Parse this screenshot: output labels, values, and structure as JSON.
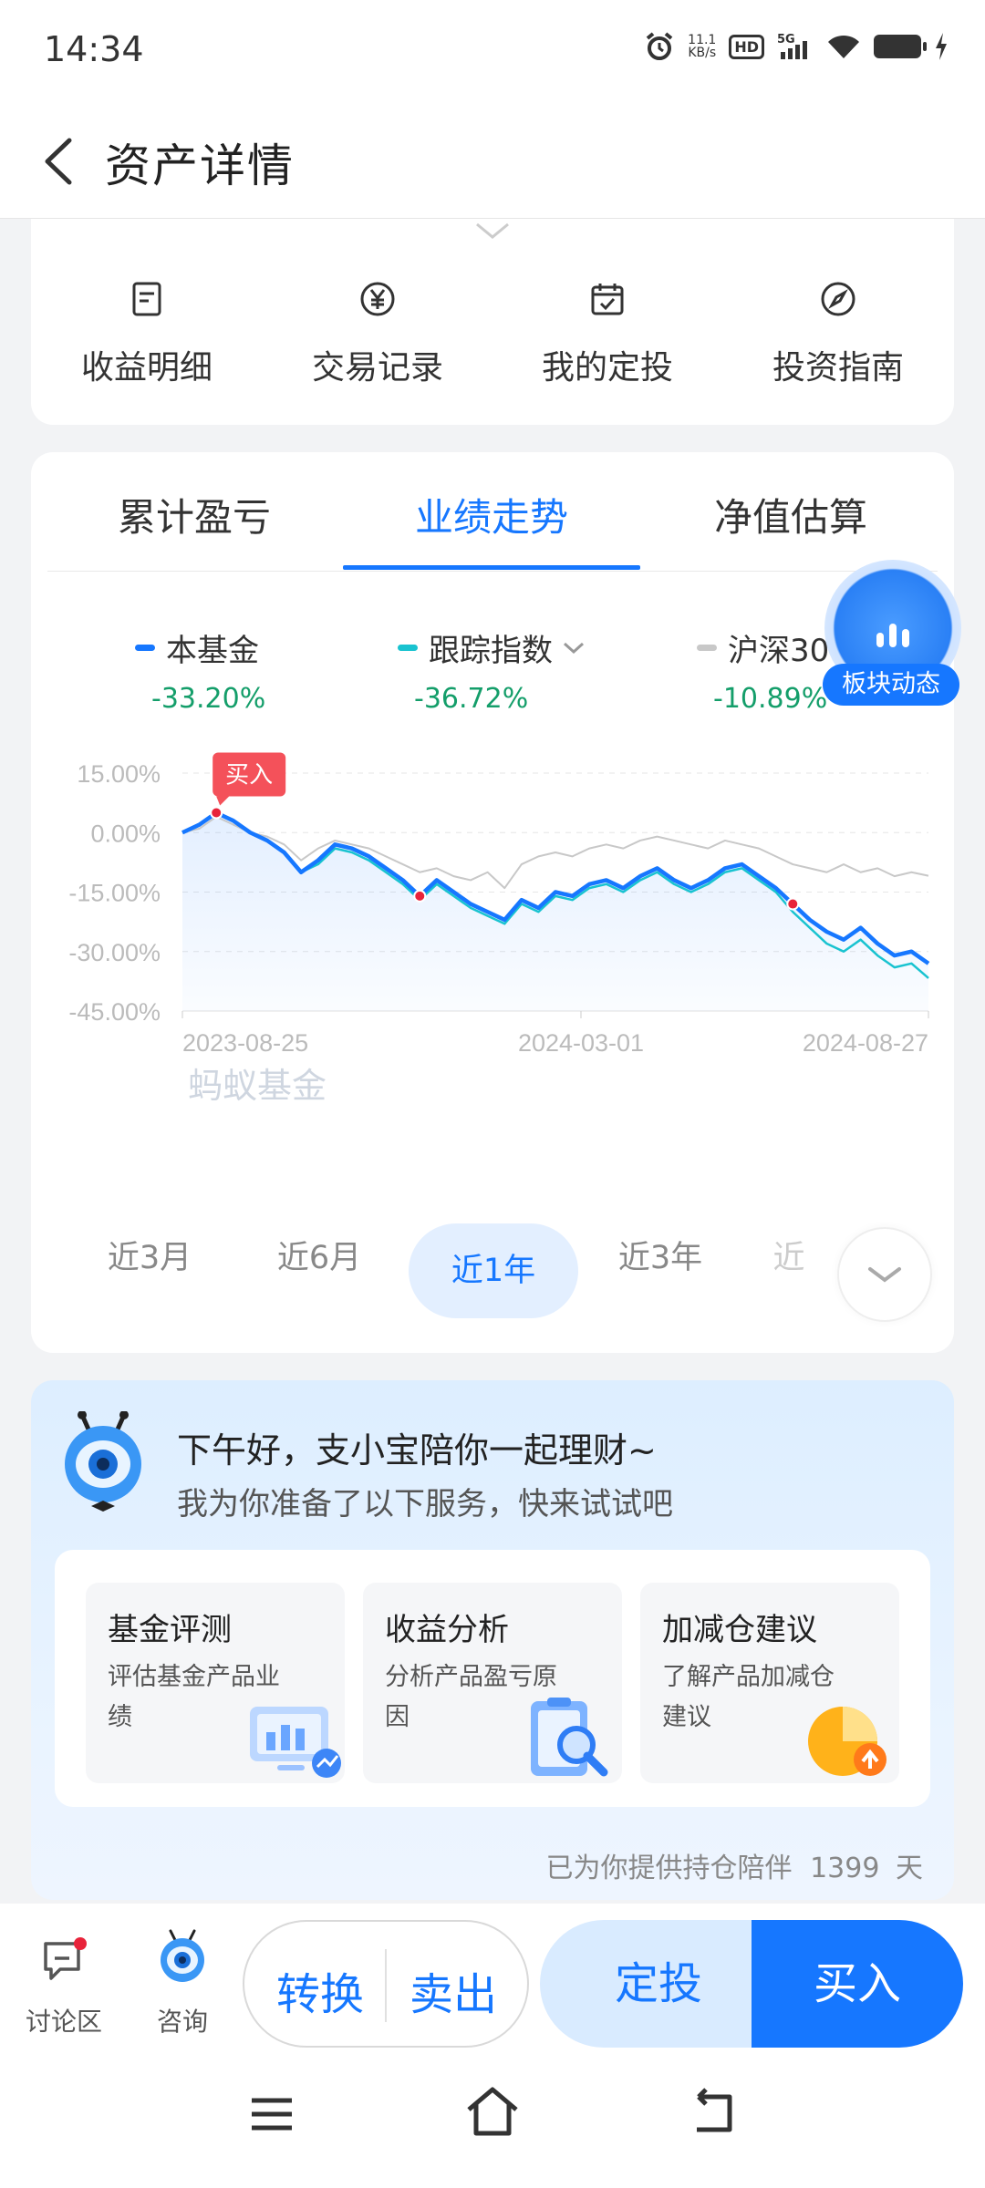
{
  "status_bar": {
    "time": "14:34",
    "net_speed_value": "11.1",
    "net_speed_unit": "KB/s",
    "hd": "HD",
    "signal": "5G"
  },
  "header": {
    "title": "资产详情"
  },
  "quick_actions": [
    {
      "label": "收益明细",
      "icon": "list-icon"
    },
    {
      "label": "交易记录",
      "icon": "yen-circle-icon"
    },
    {
      "label": "我的定投",
      "icon": "calendar-check-icon"
    },
    {
      "label": "投资指南",
      "icon": "compass-icon"
    }
  ],
  "perf_tabs": [
    "累计盈亏",
    "业绩走势",
    "净值估算"
  ],
  "active_tab": "业绩走势",
  "legend": [
    {
      "name": "本基金",
      "value": "-33.20%",
      "color": "#1677ff"
    },
    {
      "name": "跟踪指数",
      "value": "-36.72%",
      "color": "#19c3d0"
    },
    {
      "name": "沪深300",
      "value": "-10.89%",
      "color": "#c8c8c8"
    }
  ],
  "float_button": {
    "label": "板块动态",
    "icon": "bar-chart-icon"
  },
  "chart_data": {
    "type": "line",
    "ytick_labels": [
      "15.00%",
      "0.00%",
      "-15.00%",
      "-30.00%",
      "-45.00%"
    ],
    "ylim": [
      -45,
      15
    ],
    "xtick_labels": [
      "2023-08-25",
      "2024-03-01",
      "2024-08-27"
    ],
    "watermark": "蚂蚁基金",
    "buy_marker": "买入",
    "series": [
      {
        "name": "本基金",
        "color": "#1677ff",
        "values": [
          0,
          2,
          5,
          3,
          0,
          -2,
          -5,
          -10,
          -7,
          -3,
          -4,
          -6,
          -9,
          -12,
          -16,
          -12,
          -15,
          -18,
          -20,
          -22,
          -17,
          -19,
          -15,
          -16,
          -13,
          -12,
          -14,
          -11,
          -9,
          -12,
          -14,
          -12,
          -9,
          -8,
          -11,
          -14,
          -18,
          -22,
          -25,
          -27,
          -24,
          -28,
          -31,
          -30,
          -33
        ]
      },
      {
        "name": "跟踪指数",
        "color": "#19c3d0",
        "values": [
          0,
          2,
          5,
          3,
          0,
          -2,
          -5,
          -10,
          -8,
          -4,
          -5,
          -7,
          -10,
          -13,
          -17,
          -13,
          -16,
          -19,
          -21,
          -23,
          -18,
          -20,
          -16,
          -17,
          -14,
          -13,
          -15,
          -12,
          -10,
          -13,
          -15,
          -13,
          -10,
          -9,
          -12,
          -15,
          -20,
          -24,
          -28,
          -30,
          -27,
          -31,
          -34,
          -33,
          -36.7
        ]
      },
      {
        "name": "沪深300",
        "color": "#c8c8c8",
        "values": [
          0,
          1,
          4,
          2,
          0,
          -1,
          -3,
          -7,
          -4,
          -2,
          -3,
          -4,
          -6,
          -8,
          -10,
          -9,
          -11,
          -12,
          -10,
          -14,
          -8,
          -6,
          -5,
          -6,
          -4,
          -3,
          -4,
          -2,
          -1,
          -2,
          -3,
          -4,
          -2,
          -3,
          -4,
          -6,
          -8,
          -9,
          -10,
          -8,
          -10,
          -9,
          -11,
          -10,
          -10.9
        ]
      }
    ],
    "buy_points": [
      2,
      14,
      36
    ]
  },
  "periods": [
    "近3月",
    "近6月",
    "近1年",
    "近3年",
    "近"
  ],
  "active_period": "近1年",
  "assistant": {
    "greeting": "下午好，支小宝陪你一起理财~",
    "sub": "我为你准备了以下服务，快来试试吧",
    "services": [
      {
        "title": "基金评测",
        "desc": "评估基金产品业绩",
        "icon": "monitor-chart-icon"
      },
      {
        "title": "收益分析",
        "desc": "分析产品盈亏原因",
        "icon": "magnifier-report-icon"
      },
      {
        "title": "加减仓建议",
        "desc": "了解产品加减仓建议",
        "icon": "pie-chart-icon"
      }
    ],
    "footer_prefix": "已为你提供持仓陪伴",
    "footer_days": "1399",
    "footer_suffix": "天"
  },
  "bottom_bar": {
    "discuss": "讨论区",
    "consult": "咨询",
    "convert": "转换",
    "sell": "卖出",
    "dingtou": "定投",
    "buy": "买入"
  }
}
